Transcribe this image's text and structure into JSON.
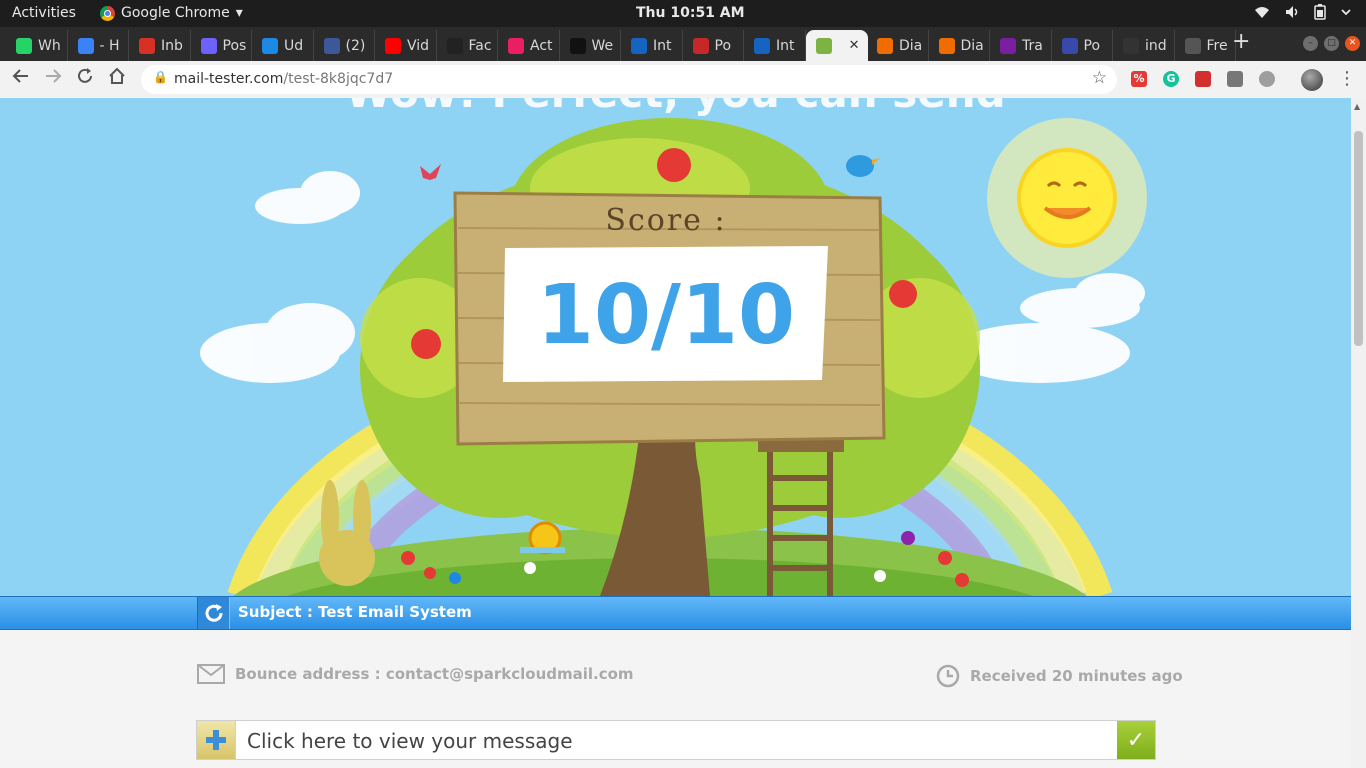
{
  "os_bar": {
    "activities": "Activities",
    "app_name": "Google Chrome",
    "app_menu_arrow": "▾",
    "clock": "Thu 10:51 AM",
    "tray_icons": [
      "wifi-icon",
      "volume-icon",
      "battery-icon",
      "power-menu-icon"
    ]
  },
  "tabs": [
    {
      "label": "Wh",
      "icon": "whatsapp-icon",
      "color": "#25d366"
    },
    {
      "label": "- H",
      "icon": "feather-icon",
      "color": "#3b82f6"
    },
    {
      "label": "Inb",
      "icon": "gmail-icon",
      "color": "#d93025"
    },
    {
      "label": "Pos",
      "icon": "video-icon",
      "color": "#6c63ff"
    },
    {
      "label": "Ud",
      "icon": "udemy-icon",
      "color": "#1e88e5"
    },
    {
      "label": "(2)",
      "icon": "facebook-icon",
      "color": "#3b5998"
    },
    {
      "label": "Vid",
      "icon": "youtube-icon",
      "color": "#ff0000"
    },
    {
      "label": "Fac",
      "icon": "github-icon",
      "color": "#222222"
    },
    {
      "label": "Act",
      "icon": "colorful-icon",
      "color": "#e91e63"
    },
    {
      "label": "We",
      "icon": "wt-icon",
      "color": "#111111"
    },
    {
      "label": "Int",
      "icon": "site-icon",
      "color": "#1565c0"
    },
    {
      "label": "Po",
      "icon": "gear-red-icon",
      "color": "#c62828"
    },
    {
      "label": "Int",
      "icon": "site-icon",
      "color": "#1565c0"
    },
    {
      "label": "",
      "icon": "leaf-icon",
      "color": "#7cb342",
      "active": true
    },
    {
      "label": "Dia",
      "icon": "diamond-icon",
      "color": "#ef6c00"
    },
    {
      "label": "Dia",
      "icon": "diamond-icon",
      "color": "#ef6c00"
    },
    {
      "label": "Tra",
      "icon": "colorful-icon",
      "color": "#7b1fa2"
    },
    {
      "label": "Po",
      "icon": "brackets-icon",
      "color": "#3949ab"
    },
    {
      "label": "ind",
      "icon": "dark-icon",
      "color": "#333333"
    },
    {
      "label": "Fre",
      "icon": "grid-icon",
      "color": "#555555"
    }
  ],
  "new_tab": "+",
  "address": {
    "domain": "mail-tester.com",
    "path": "/test-8k8jqc7d7"
  },
  "hero": {
    "title": "Wow! Perfect, you can send",
    "score_label": "Score :",
    "score_value": "10/10"
  },
  "subject": {
    "text": "Subject : Test Email System"
  },
  "meta": {
    "bounce": "Bounce address : contact@sparkcloudmail.com",
    "received": "Received 20 minutes ago"
  },
  "view_message": {
    "label": "Click here to view your message"
  },
  "colors": {
    "sky": "#8fd3f4",
    "score_blue": "#3fa3ea",
    "subject_bar": "#2b8fe6",
    "check_green": "#8bbd22"
  }
}
